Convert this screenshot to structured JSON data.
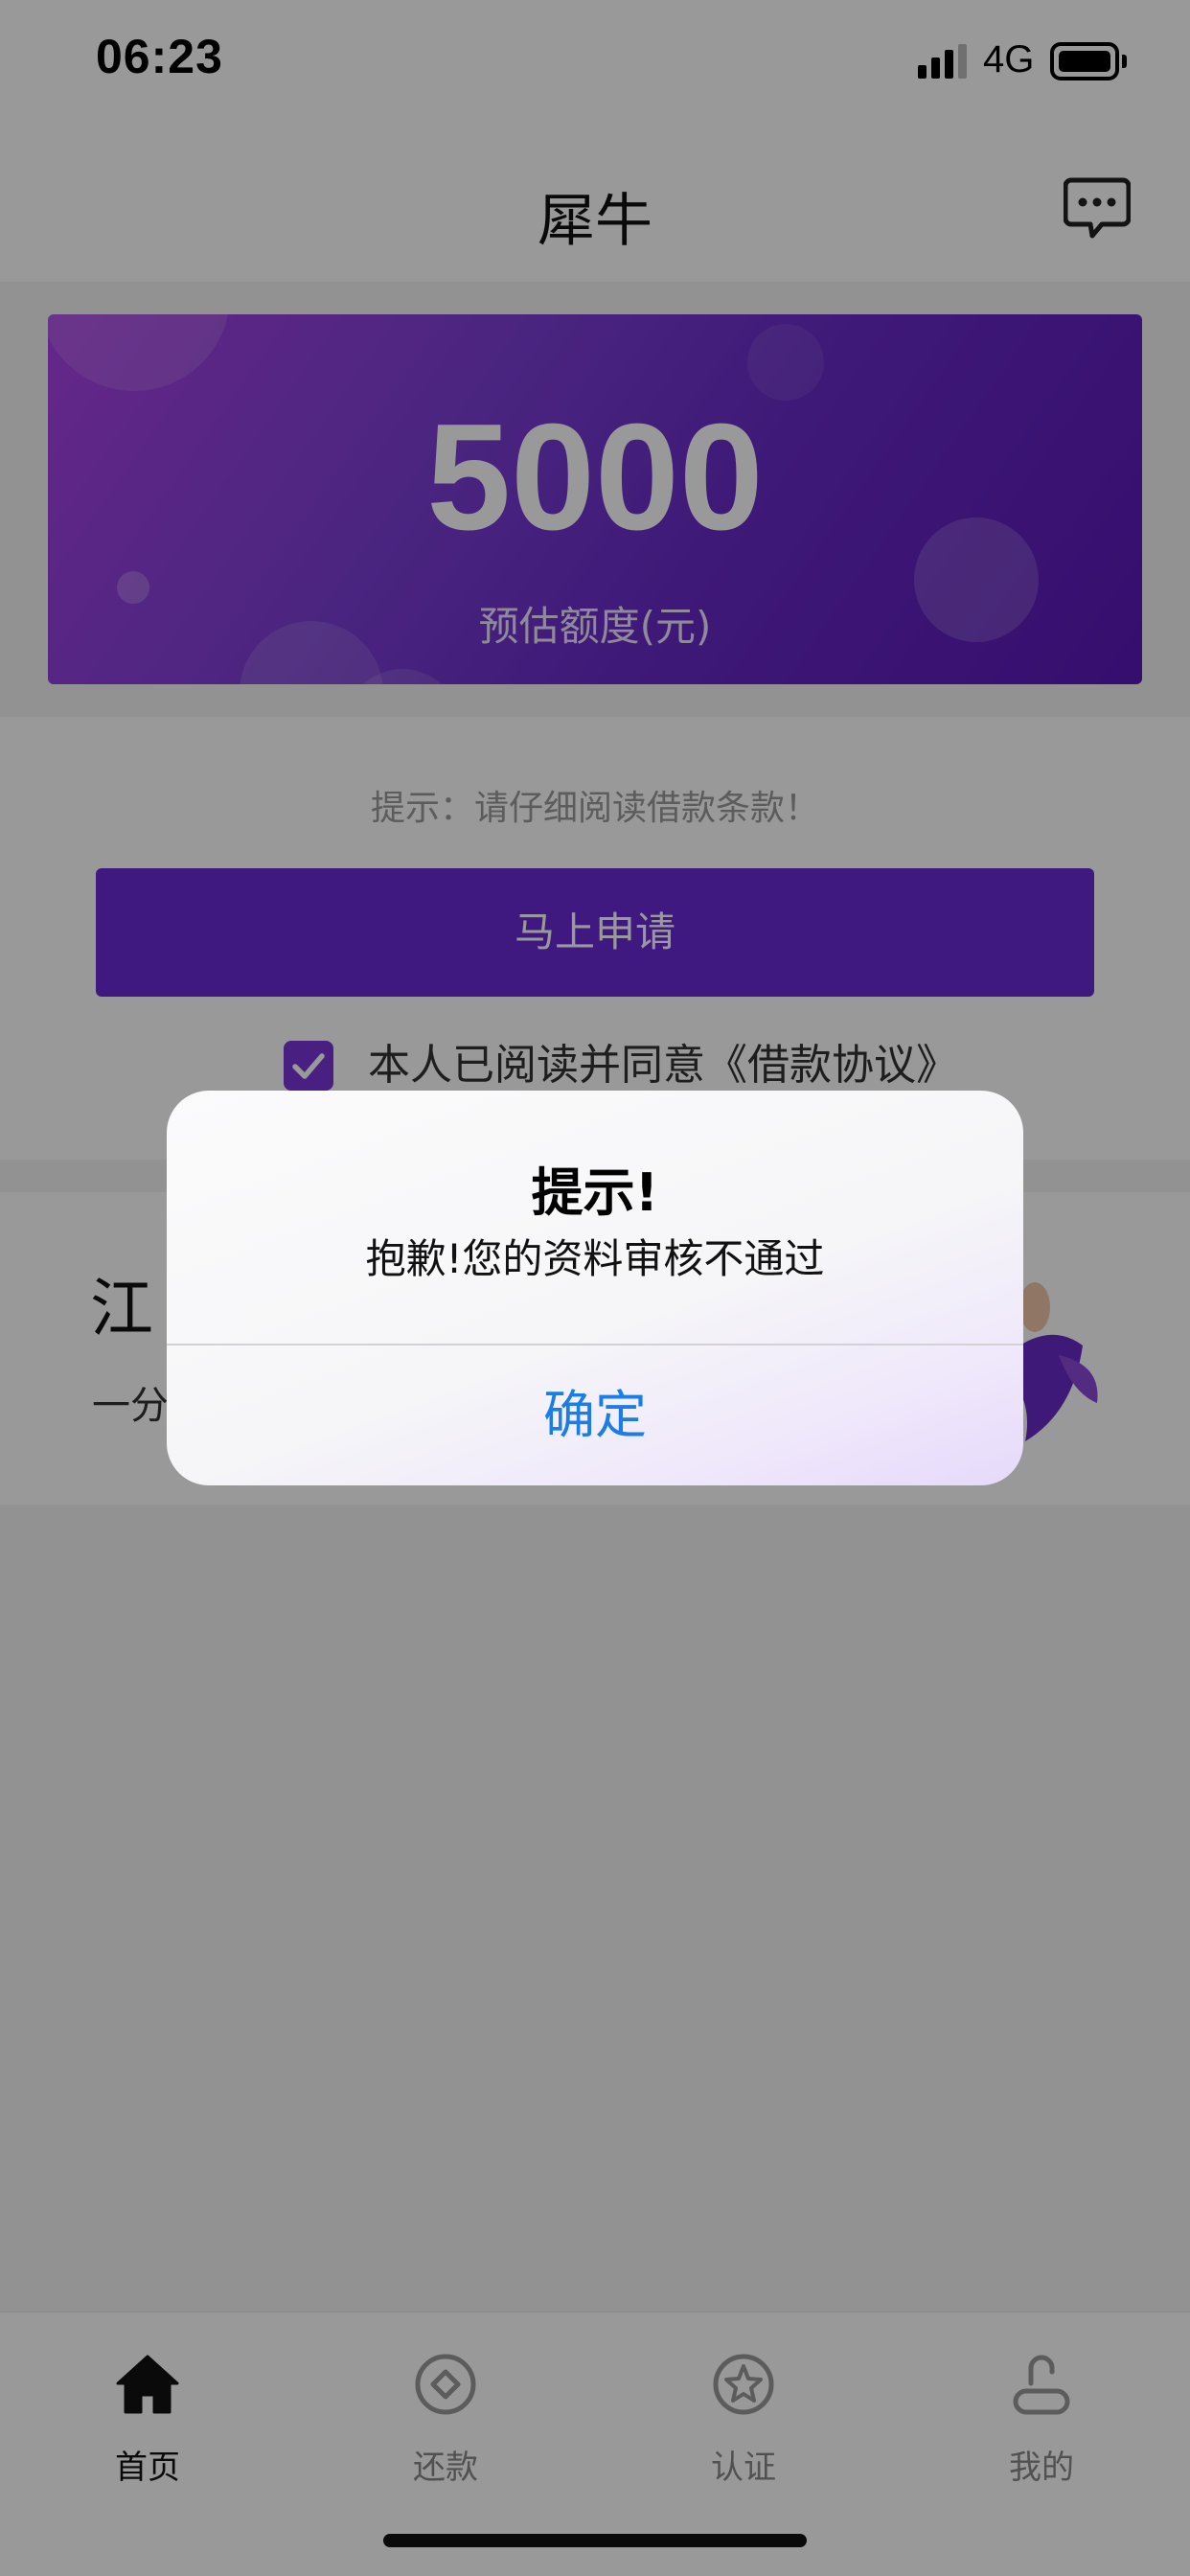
{
  "status_bar": {
    "time": "06:23",
    "network": "4G",
    "icons": [
      "signal-icon",
      "battery-icon"
    ]
  },
  "header": {
    "title": "犀牛",
    "message_icon": "message-icon"
  },
  "hero": {
    "amount": "5000",
    "label": "预估额度(元)",
    "colors": {
      "gradient_start": "#a941e6",
      "gradient_end": "#5a17b8"
    }
  },
  "apply": {
    "tip": "提示：请仔细阅读借款条款！",
    "button_label": "马上申请",
    "agree_checked": true,
    "agree_text": "本人已阅读并同意",
    "agreement_link": "《借款协议》"
  },
  "promo": {
    "title_visible": "江",
    "subtitle_visible": "一分"
  },
  "tabs": [
    {
      "label": "首页",
      "icon": "home-icon",
      "active": true
    },
    {
      "label": "还款",
      "icon": "repay-icon",
      "active": false
    },
    {
      "label": "认证",
      "icon": "certify-icon",
      "active": false
    },
    {
      "label": "我的",
      "icon": "profile-icon",
      "active": false
    }
  ],
  "dialog": {
    "title": "提示!",
    "message": "抱歉!您的资料审核不通过",
    "confirm_label": "确定"
  },
  "colors": {
    "accent": "#6b2ad6",
    "dialog_button": "#1a7ee6"
  }
}
